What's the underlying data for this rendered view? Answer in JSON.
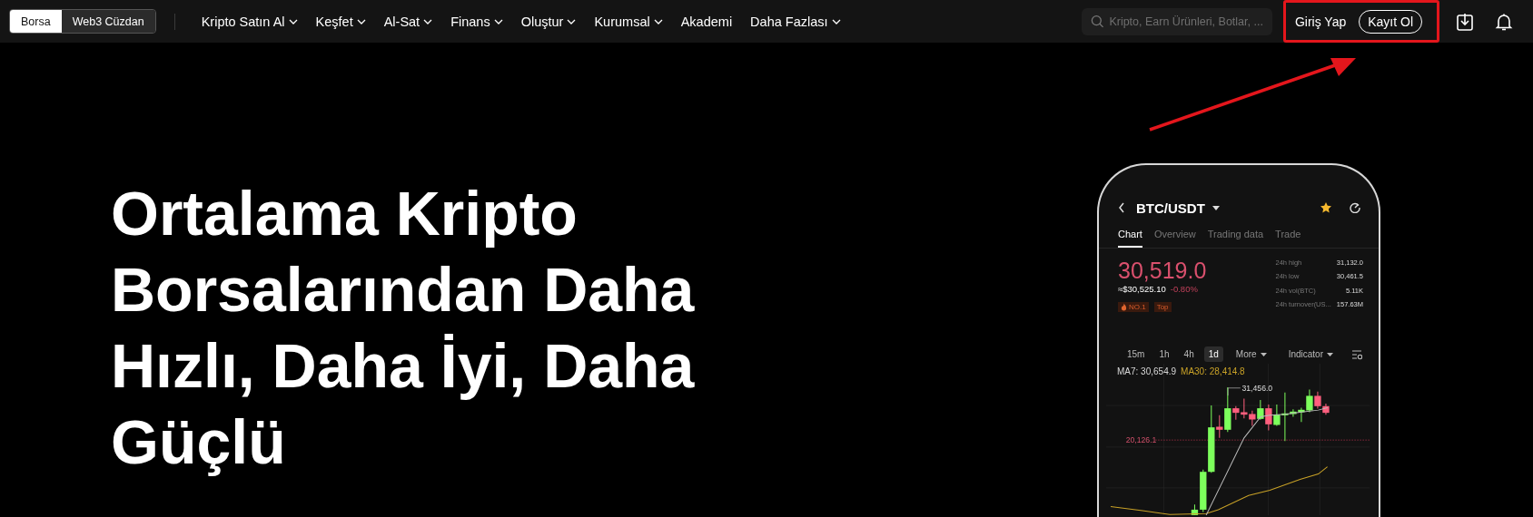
{
  "nav": {
    "mode_toggle": [
      {
        "label": "Borsa",
        "selected": true
      },
      {
        "label": "Web3 Cüzdan",
        "selected": false
      }
    ],
    "menu": [
      {
        "label": "Kripto Satın Al",
        "dropdown": true
      },
      {
        "label": "Keşfet",
        "dropdown": true
      },
      {
        "label": "Al-Sat",
        "dropdown": true
      },
      {
        "label": "Finans",
        "dropdown": true
      },
      {
        "label": "Oluştur",
        "dropdown": true
      },
      {
        "label": "Kurumsal",
        "dropdown": true
      },
      {
        "label": "Akademi",
        "dropdown": false
      },
      {
        "label": "Daha Fazlası",
        "dropdown": true
      }
    ],
    "search": {
      "placeholder": "Kripto, Earn Ürünleri, Botlar, ..."
    },
    "login": "Giriş Yap",
    "signup": "Kayıt Ol"
  },
  "hero": {
    "title": "Ortalama Kripto Borsalarından Daha Hızlı, Daha İyi, Daha Güçlü"
  },
  "phone": {
    "pair": "BTC/USDT",
    "favorite": true,
    "tabs": [
      {
        "label": "Chart",
        "selected": true
      },
      {
        "label": "Overview",
        "selected": false
      },
      {
        "label": "Trading data",
        "selected": false
      },
      {
        "label": "Trade",
        "selected": false
      }
    ],
    "price": "30,519.0",
    "fiat_price": "≈$30,525.10",
    "change": "-0.80%",
    "tags": [
      {
        "label": "NO.1",
        "kind": "rank"
      },
      {
        "label": "Top",
        "kind": "plain"
      }
    ],
    "stats": [
      {
        "label": "24h high",
        "value": "31,132.0"
      },
      {
        "label": "24h low",
        "value": "30,461.5"
      },
      {
        "label": "24h vol(BTC)",
        "value": "5.11K"
      },
      {
        "label": "24h turnover(US...",
        "value": "157.63M"
      }
    ],
    "timeframes": [
      {
        "label": "15m",
        "selected": false
      },
      {
        "label": "1h",
        "selected": false
      },
      {
        "label": "4h",
        "selected": false
      },
      {
        "label": "1d",
        "selected": true
      }
    ],
    "menus": [
      "More",
      "Indicator"
    ],
    "ma": [
      {
        "label": "MA7: 30,654.9",
        "color": "#d8d8d8"
      },
      {
        "label": "MA30: 28,414.8",
        "color": "#c9a227"
      }
    ],
    "high_marker": "31,456.0",
    "price_line": "20,126.1"
  }
}
